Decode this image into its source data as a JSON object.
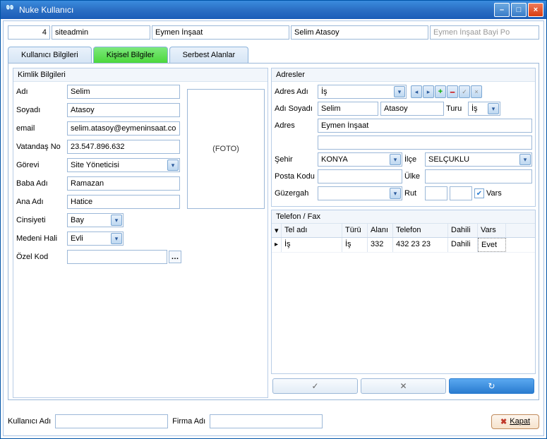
{
  "window": {
    "title": "Nuke Kullanıcı"
  },
  "toprow": {
    "id": "4",
    "username": "siteadmin",
    "company": "Eymen İnşaat",
    "fullname": "Selim Atasoy",
    "placeholder": "Eymen İnşaat Bayi Po"
  },
  "tabs": {
    "t1": "Kullanıcı Bilgileri",
    "t2": "Kişisel Bilgiler",
    "t3": "Serbest Alanlar"
  },
  "kimlik": {
    "title": "Kimlik Bilgileri",
    "photo": "(FOTO)",
    "labels": {
      "adi": "Adı",
      "soyadi": "Soyadı",
      "email": "email",
      "vatandas": "Vatandaş No",
      "gorevi": "Görevi",
      "baba": "Baba Adı",
      "ana": "Ana Adı",
      "cinsiyet": "Cinsiyeti",
      "medeni": "Medeni Hali",
      "ozel": "Özel Kod"
    },
    "values": {
      "adi": "Selim",
      "soyadi": "Atasoy",
      "email": "selim.atasoy@eymeninsaat.com.t",
      "vatandas": "23.547.896.632",
      "gorevi": "Site Yöneticisi",
      "baba": "Ramazan",
      "ana": "Hatice",
      "cinsiyet": "Bay",
      "medeni": "Evli",
      "ozel": ""
    }
  },
  "adresler": {
    "title": "Adresler",
    "labels": {
      "adresadi": "Adres Adı",
      "adisoyadi": "Adı Soyadı",
      "turu": "Turu",
      "adres": "Adres",
      "sehir": "Şehir",
      "ilce": "İlçe",
      "posta": "Posta Kodu",
      "ulke": "Ülke",
      "guzergah": "Güzergah",
      "rut": "Rut",
      "vars": "Vars"
    },
    "values": {
      "adresadi": "İş",
      "ad": "Selim",
      "soyad": "Atasoy",
      "turu": "İş",
      "adres1": "Eymen İnşaat",
      "adres2": "",
      "sehir": "KONYA",
      "ilce": "SELÇUKLU",
      "posta": "",
      "ulke": "",
      "guzergah": "",
      "rut1": "",
      "rut2": "",
      "vars_checked": true
    }
  },
  "telefon": {
    "title": "Telefon / Fax",
    "headers": {
      "teladi": "Tel adı",
      "turu": "Türü",
      "alan": "Alanı",
      "telefon": "Telefon",
      "dahili": "Dahili",
      "vars": "Vars"
    },
    "rows": [
      {
        "teladi": "İş",
        "turu": "İş",
        "alan": "332",
        "telefon": "432 23 23",
        "dahili": "Dahili",
        "vars": "Evet"
      }
    ]
  },
  "abuttons": {
    "ok": "✓",
    "cancel": "✕",
    "refresh": "↻"
  },
  "footer": {
    "kullanici_label": "Kullanıcı Adı",
    "firma_label": "Firma Adı",
    "kapat": "Kapat"
  }
}
